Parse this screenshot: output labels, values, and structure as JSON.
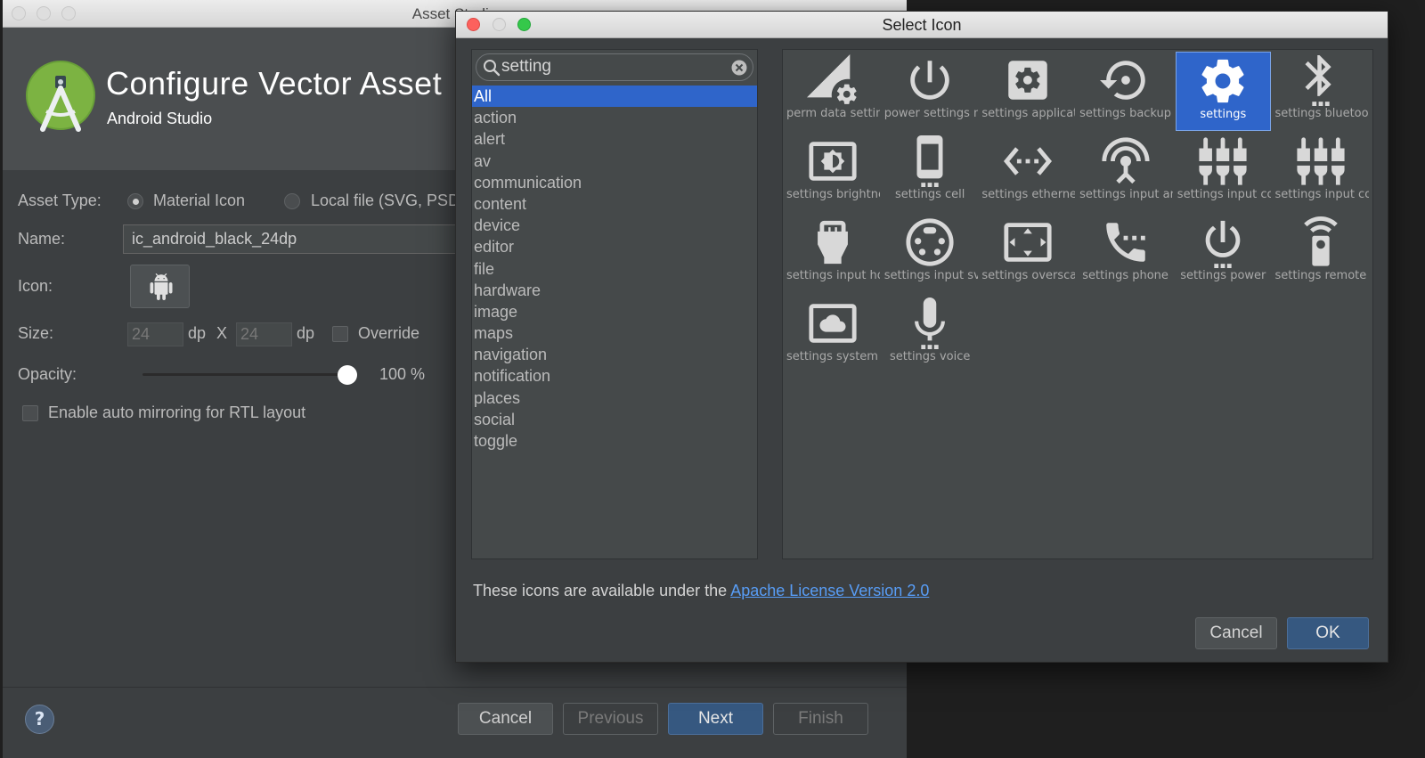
{
  "asset_window": {
    "title": "Asset Studio",
    "header_title": "Configure Vector Asset",
    "header_subtitle": "Android Studio",
    "asset_type_label": "Asset Type:",
    "option_material_icon": "Material Icon",
    "option_local_file": "Local file (SVG, PSD)",
    "name_label": "Name:",
    "name_value": "ic_android_black_24dp",
    "icon_label": "Icon:",
    "size_label": "Size:",
    "size_width": "24",
    "size_height": "24",
    "dp1": "dp",
    "x_sep": "X",
    "dp2": "dp",
    "override_label": "Override",
    "opacity_label": "Opacity:",
    "opacity_value": "100 %",
    "opacity_percent": 100,
    "rtl_label": "Enable auto mirroring for RTL layout",
    "help_label": "?",
    "buttons": {
      "cancel": "Cancel",
      "previous": "Previous",
      "next": "Next",
      "finish": "Finish"
    }
  },
  "dialog": {
    "title": "Select Icon",
    "search": {
      "value": "setting",
      "placeholder": ""
    },
    "categories": [
      "All",
      "action",
      "alert",
      "av",
      "communication",
      "content",
      "device",
      "editor",
      "file",
      "hardware",
      "image",
      "maps",
      "navigation",
      "notification",
      "places",
      "social",
      "toggle"
    ],
    "selected_category": "All",
    "icons": [
      {
        "label": "perm data setting",
        "icon": "perm-data-setting-icon"
      },
      {
        "label": "power settings new",
        "icon": "power-settings-new-icon"
      },
      {
        "label": "settings applications",
        "icon": "settings-applications-icon"
      },
      {
        "label": "settings backup restore",
        "icon": "settings-backup-restore-icon"
      },
      {
        "label": "settings",
        "icon": "settings-icon",
        "selected": true
      },
      {
        "label": "settings bluetooth",
        "icon": "settings-bluetooth-icon"
      },
      {
        "label": "settings brightness",
        "icon": "settings-brightness-icon"
      },
      {
        "label": "settings cell",
        "icon": "settings-cell-icon"
      },
      {
        "label": "settings ethernet",
        "icon": "settings-ethernet-icon"
      },
      {
        "label": "settings input antenna",
        "icon": "settings-input-antenna-icon"
      },
      {
        "label": "settings input component",
        "icon": "settings-input-component-icon"
      },
      {
        "label": "settings input composite",
        "icon": "settings-input-composite-icon"
      },
      {
        "label": "settings input hdmi",
        "icon": "settings-input-hdmi-icon"
      },
      {
        "label": "settings input svideo",
        "icon": "settings-input-svideo-icon"
      },
      {
        "label": "settings overscan",
        "icon": "settings-overscan-icon"
      },
      {
        "label": "settings phone",
        "icon": "settings-phone-icon"
      },
      {
        "label": "settings power",
        "icon": "settings-power-icon"
      },
      {
        "label": "settings remote",
        "icon": "settings-remote-icon"
      },
      {
        "label": "settings system daydream",
        "icon": "settings-system-daydream-icon"
      },
      {
        "label": "settings voice",
        "icon": "settings-voice-icon"
      }
    ],
    "license_prefix": "These icons are available under the ",
    "license_link": "Apache License Version 2.0",
    "cancel": "Cancel",
    "ok": "OK"
  },
  "colors": {
    "accent": "#2f65ca",
    "panel": "#3c3f41",
    "link": "#589df6",
    "icon_fill": "#d8d8d8"
  }
}
